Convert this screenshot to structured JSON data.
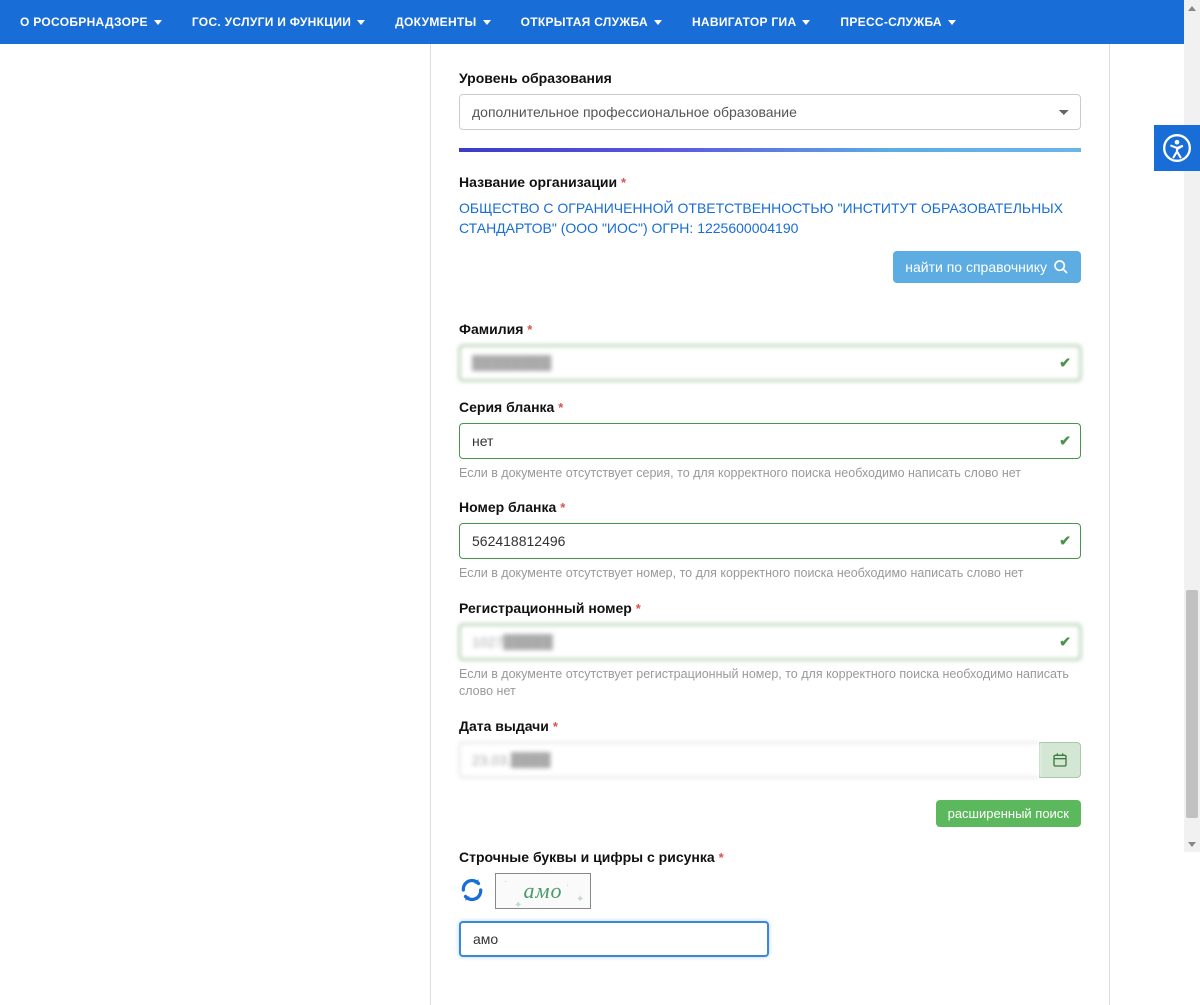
{
  "nav": {
    "items": [
      "О РОСОБРНАДЗОРЕ",
      "ГОС. УСЛУГИ И ФУНКЦИИ",
      "ДОКУМЕНТЫ",
      "ОТКРЫТАЯ СЛУЖБА",
      "НАВИГАТОР ГИА",
      "ПРЕСС-СЛУЖБА"
    ]
  },
  "form": {
    "education_level": {
      "label": "Уровень образования",
      "value": "дополнительное профессиональное образование"
    },
    "organization": {
      "label": "Название организации",
      "value": "ОБЩЕСТВО С ОГРАНИЧЕННОЙ ОТВЕТСТВЕННОСТЬЮ \"ИНСТИТУТ ОБРАЗОВАТЕЛЬНЫХ СТАНДАРТОВ\" (ООО \"ИОС\") ОГРН: 1225600004190",
      "lookup_label": "найти по справочнику"
    },
    "surname": {
      "label": "Фамилия",
      "value": "████████"
    },
    "blank_series": {
      "label": "Серия бланка",
      "value": "нет",
      "helper": "Если в документе отсутствует серия, то для корректного поиска необходимо написать слово нет"
    },
    "blank_number": {
      "label": "Номер бланка",
      "value": "562418812496",
      "helper": "Если в документе отсутствует номер, то для корректного поиска необходимо написать слово нет"
    },
    "reg_number": {
      "label": "Регистрационный номер",
      "value": "1027█████",
      "helper": "Если в документе отсутствует регистрационный номер, то для корректного поиска необходимо написать слово нет"
    },
    "issue_date": {
      "label": "Дата выдачи",
      "value": "23.03.████"
    },
    "extended_search": "расширенный поиск",
    "captcha": {
      "label": "Строчные буквы и цифры с рисунка",
      "image_text": "aмо",
      "value": "амо"
    }
  }
}
